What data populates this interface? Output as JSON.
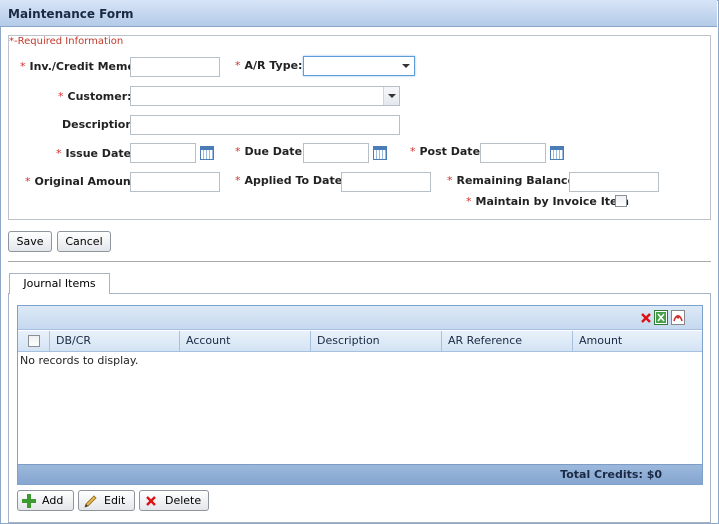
{
  "title": "Maintenance Form",
  "required_info": "*-Required Information",
  "fields": {
    "inv_credit_memo": {
      "label": "Inv./Credit Memo:",
      "value": ""
    },
    "ar_type": {
      "label": "A/R Type:",
      "value": ""
    },
    "customer": {
      "label": "Customer:",
      "value": ""
    },
    "description": {
      "label": "Description:",
      "value": ""
    },
    "issue_date": {
      "label": "Issue Date:",
      "value": ""
    },
    "due_date": {
      "label": "Due Date:",
      "value": ""
    },
    "post_date": {
      "label": "Post Date:",
      "value": ""
    },
    "original_amount": {
      "label": "Original Amount:",
      "value": ""
    },
    "applied_to_date": {
      "label": "Applied To Date:",
      "value": ""
    },
    "remaining_balance": {
      "label": "Remaining Balance:",
      "value": ""
    },
    "maintain_by_invoice_item": {
      "label": "Maintain by Invoice Item",
      "checked": false
    }
  },
  "required_marker": "*",
  "buttons": {
    "save": "Save",
    "cancel": "Cancel"
  },
  "tab": {
    "label": "Journal Items"
  },
  "grid": {
    "columns": [
      "DB/CR",
      "Account",
      "Description",
      "AR Reference",
      "Amount"
    ],
    "no_records": "No records to display.",
    "footer": "Total Credits: $0",
    "toolbar_icons": [
      "delete-x-icon",
      "excel-export-icon",
      "pdf-export-icon"
    ]
  },
  "actions": {
    "add": "Add",
    "edit": "Edit",
    "delete": "Delete"
  },
  "colors": {
    "required": "#d0312d",
    "header_bg": "#c6d9ef",
    "footer_bg": "#86a6d0"
  }
}
